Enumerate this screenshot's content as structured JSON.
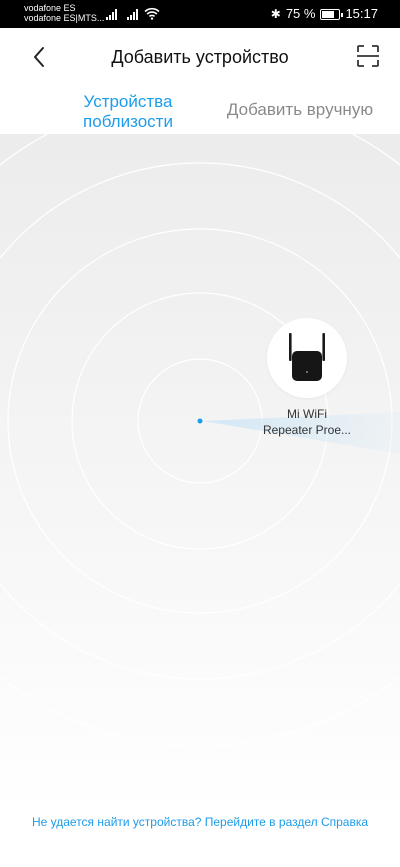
{
  "status_bar": {
    "carrier_1": "vodafone ES",
    "carrier_2": "vodafone ES|MTS...",
    "sim_tag_1": "ıl",
    "sim_tag_2": "ıl",
    "battery_text": "75 %",
    "battery_level": 0.75,
    "time": "15:17"
  },
  "header": {
    "title": "Добавить устройство"
  },
  "tabs": {
    "nearby_line1": "Устройства",
    "nearby_line2": "поблизости",
    "manual": "Добавить вручную"
  },
  "device": {
    "name_line1": "Mi WiFi",
    "name_line2": "Repeater Proe..."
  },
  "footer": {
    "help_text": "Не удается найти устройства? Перейдите в раздел Справка"
  },
  "colors": {
    "accent": "#1d9ce9",
    "inactive_tab": "#8a8a8a"
  },
  "icons": [
    "back-arrow-icon",
    "scan-icon",
    "wifi-icon",
    "bluetooth-icon",
    "battery-icon",
    "repeater-device-icon"
  ]
}
